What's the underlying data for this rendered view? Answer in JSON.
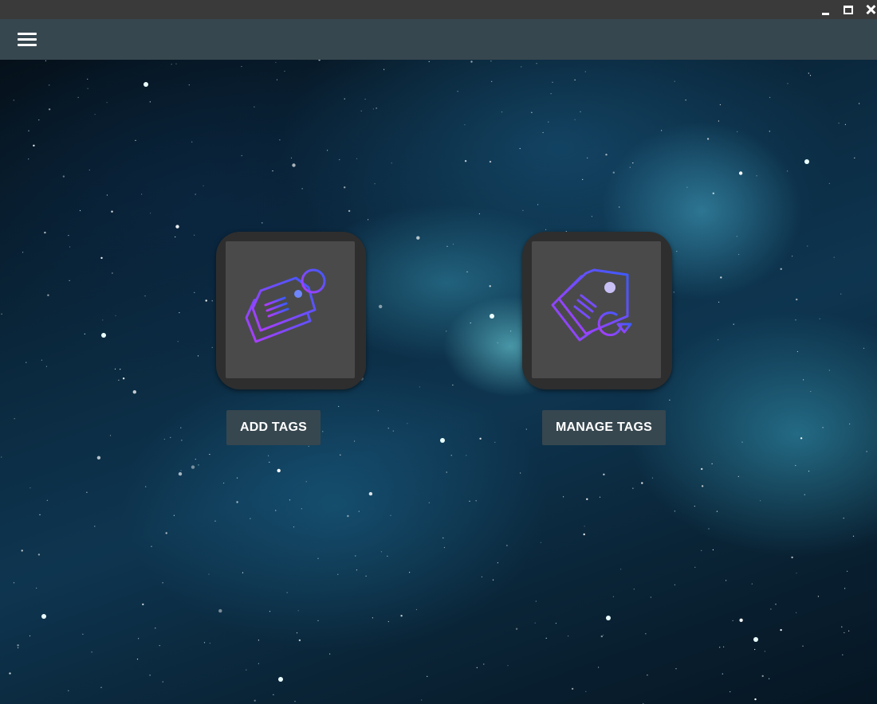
{
  "window": {
    "controls": [
      "minimize",
      "maximize",
      "close"
    ]
  },
  "toolbar": {
    "menu_icon": "hamburger-menu-icon"
  },
  "actions": [
    {
      "label": "ADD  TAGS",
      "icon": "tag-add-icon"
    },
    {
      "label": "MANAGE TAGS",
      "icon": "tag-refresh-icon"
    }
  ],
  "colors": {
    "titlebar": "#3a3a3a",
    "toolbar": "#37474f",
    "button_bg": "#37474f",
    "tile_outer": "#2e2e2e",
    "tile_inner": "#4a4a4a",
    "icon_gradient_start": "#3b5bff",
    "icon_gradient_end": "#b13cff"
  }
}
